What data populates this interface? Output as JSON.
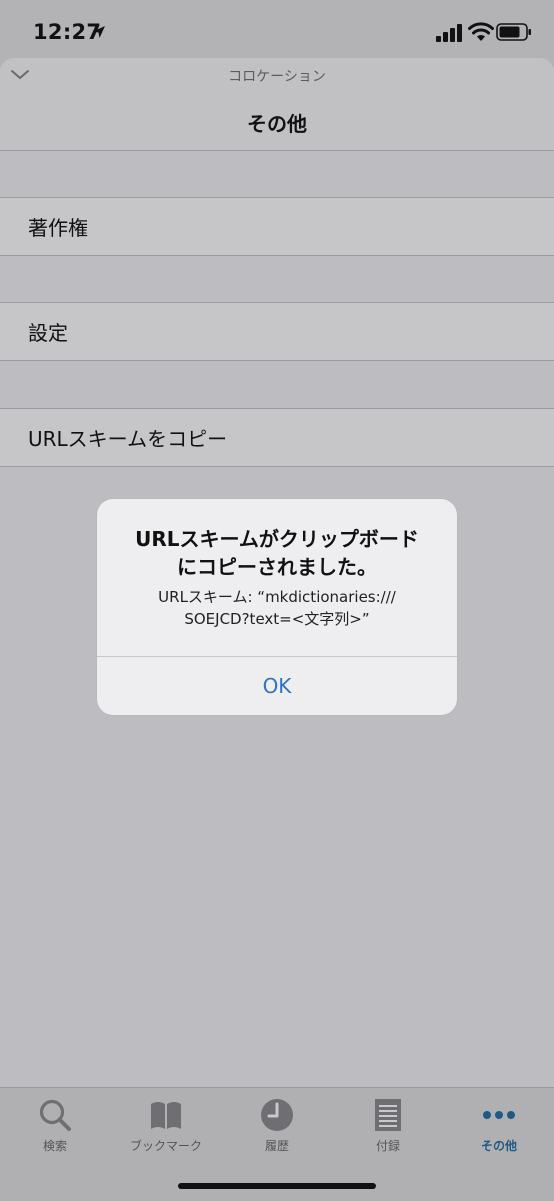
{
  "status_bar": {
    "time": "12:27"
  },
  "nav": {
    "subtitle": "コロケーション",
    "title": "その他"
  },
  "list": {
    "items": [
      {
        "label": "著作権"
      },
      {
        "label": "設定"
      },
      {
        "label": "URLスキームをコピー"
      }
    ]
  },
  "alert": {
    "title_line1": "URLスキームがクリップボード",
    "title_line2": "にコピーされました。",
    "message_line1": "URLスキーム: “mkdictionaries:///",
    "message_line2": "SOEJCD?text=<文字列>”",
    "ok_label": "OK"
  },
  "tabbar": {
    "tabs": [
      {
        "label": "検索",
        "icon": "search-icon"
      },
      {
        "label": "ブックマーク",
        "icon": "book-icon"
      },
      {
        "label": "履歴",
        "icon": "clock-icon"
      },
      {
        "label": "付録",
        "icon": "document-icon"
      },
      {
        "label": "その他",
        "icon": "more-icon",
        "active": true
      }
    ]
  },
  "colors": {
    "accent": "#2f73c3",
    "active_tab": "#1f5a86"
  }
}
